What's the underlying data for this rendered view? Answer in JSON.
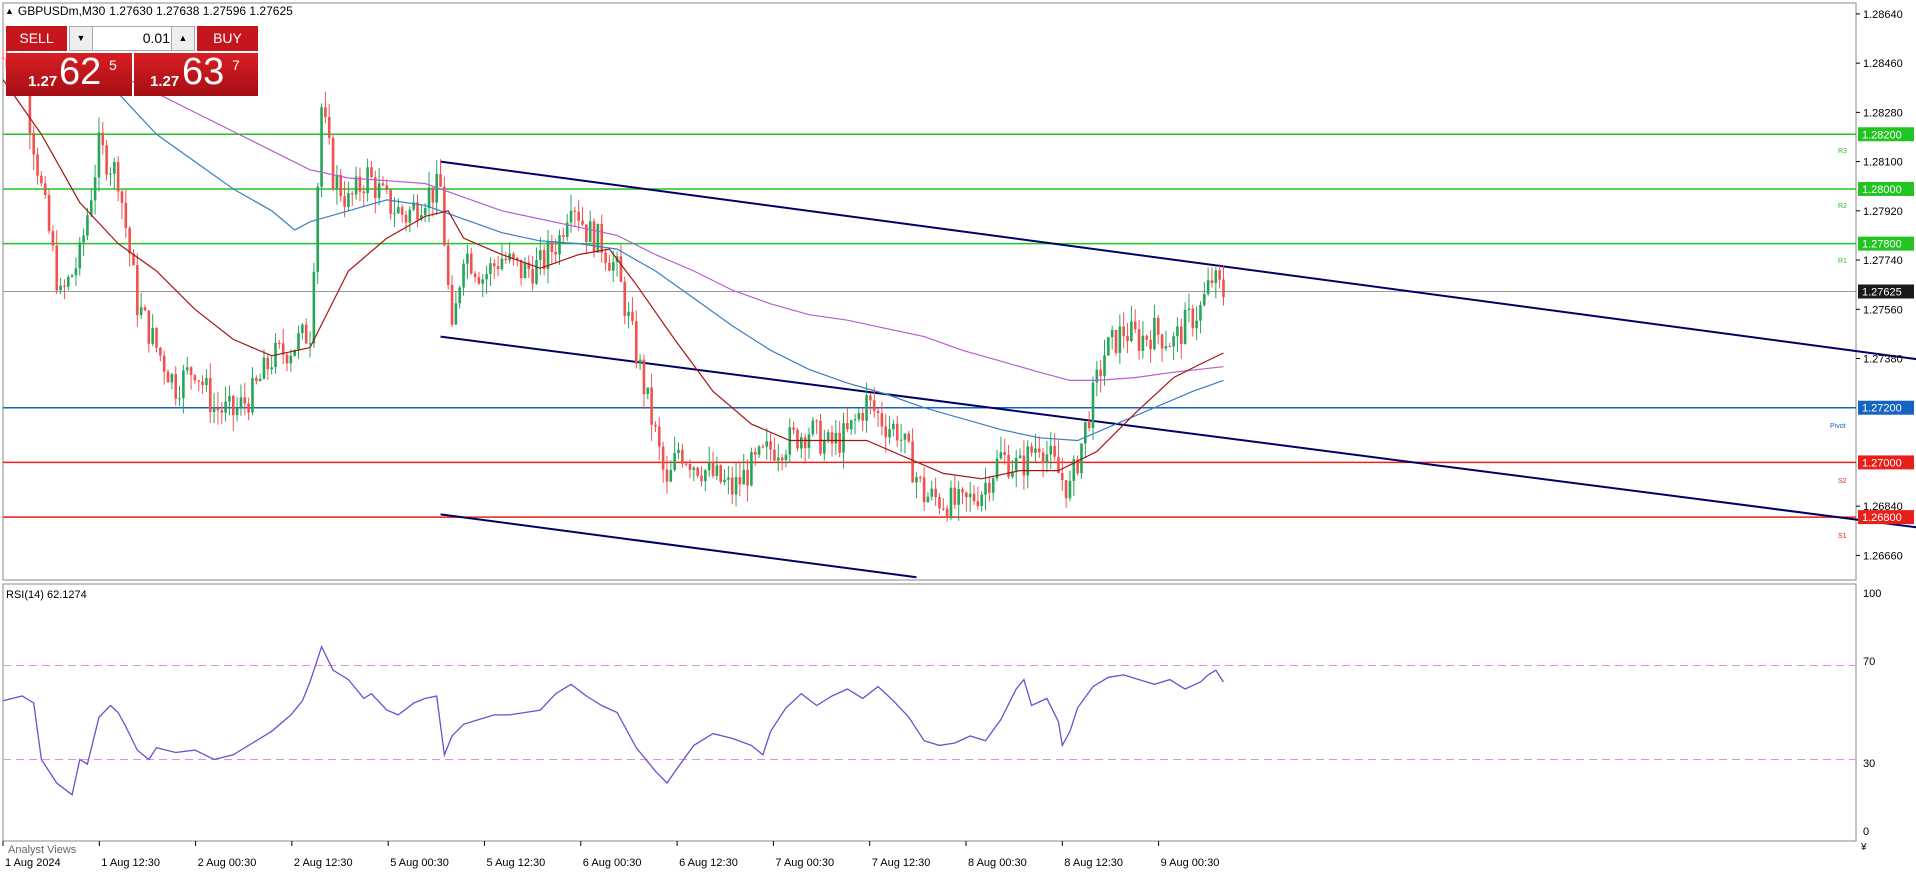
{
  "symbol_header": {
    "symbol_tf": "GBPUSDm,M30",
    "ohlc": "1.27630 1.27638 1.27596 1.27625"
  },
  "trade_panel": {
    "sell_label": "SELL",
    "buy_label": "BUY",
    "lot_value": "0.01",
    "bid": {
      "prefix": "1.27",
      "big": "62",
      "sup": "5"
    },
    "ask": {
      "prefix": "1.27",
      "big": "63",
      "sup": "7"
    }
  },
  "colors": {
    "bull": "#26a65b",
    "bear": "#ef5350",
    "ma_fast": "#a31515",
    "ma_mid": "#3a7fbf",
    "ma_slow": "#b55fd0",
    "channel": "#000066",
    "resistance": "#22c422",
    "support": "#e8201c",
    "pivot": "#1565c0",
    "rsi": "#6b4fd0",
    "rsi_levels": "#e090e0"
  },
  "chart_data": [
    {
      "type": "candlestick",
      "y_ticks": [
        "1.28640",
        "1.28460",
        "1.28280",
        "1.28100",
        "1.27920",
        "1.27740",
        "1.27560",
        "1.27380",
        "1.26840",
        "1.26660"
      ],
      "ylim": [
        1.2657,
        1.2868
      ],
      "x_ticks": [
        "1 Aug 2024",
        "1 Aug 12:30",
        "2 Aug 00:30",
        "2 Aug 12:30",
        "5 Aug 00:30",
        "5 Aug 12:30",
        "6 Aug 00:30",
        "6 Aug 12:30",
        "7 Aug 00:30",
        "7 Aug 12:30",
        "8 Aug 00:30",
        "8 Aug 12:30",
        "9 Aug 00:30"
      ],
      "current_price": "1.27625",
      "levels": [
        {
          "name": "R3",
          "price": "1.28200",
          "color": "#22c422"
        },
        {
          "name": "R2",
          "price": "1.28000",
          "color": "#22c422"
        },
        {
          "name": "R1",
          "price": "1.27800",
          "color": "#22c422"
        },
        {
          "name": "Pivot",
          "price": "1.27200",
          "color": "#1565c0"
        },
        {
          "name": "S2",
          "price": "1.27000",
          "color": "#e8201c"
        },
        {
          "name": "S1",
          "price": "1.26800",
          "color": "#e8201c"
        }
      ],
      "close_path": [
        [
          0,
          1.2848
        ],
        [
          5,
          1.2843
        ],
        [
          10,
          1.28
        ],
        [
          15,
          1.276
        ],
        [
          20,
          1.2775
        ],
        [
          25,
          1.2815
        ],
        [
          30,
          1.2805
        ],
        [
          35,
          1.2758
        ],
        [
          40,
          1.2742
        ],
        [
          45,
          1.2728
        ],
        [
          50,
          1.2735
        ],
        [
          55,
          1.272
        ],
        [
          60,
          1.2718
        ],
        [
          65,
          1.2725
        ],
        [
          70,
          1.2738
        ],
        [
          75,
          1.2742
        ],
        [
          80,
          1.2748
        ],
        [
          83,
          1.283
        ],
        [
          86,
          1.2805
        ],
        [
          90,
          1.2795
        ],
        [
          95,
          1.2805
        ],
        [
          100,
          1.2795
        ],
        [
          105,
          1.279
        ],
        [
          110,
          1.2798
        ],
        [
          114,
          1.28
        ],
        [
          117,
          1.2745
        ],
        [
          120,
          1.2778
        ],
        [
          125,
          1.2768
        ],
        [
          130,
          1.2775
        ],
        [
          135,
          1.277
        ],
        [
          140,
          1.2772
        ],
        [
          145,
          1.2782
        ],
        [
          148,
          1.2798
        ],
        [
          152,
          1.2785
        ],
        [
          156,
          1.278
        ],
        [
          160,
          1.277
        ],
        [
          165,
          1.274
        ],
        [
          170,
          1.271
        ],
        [
          173,
          1.269
        ],
        [
          176,
          1.2705
        ],
        [
          180,
          1.27
        ],
        [
          185,
          1.2695
        ],
        [
          190,
          1.269
        ],
        [
          195,
          1.2698
        ],
        [
          200,
          1.2705
        ],
        [
          205,
          1.2708
        ],
        [
          210,
          1.2712
        ],
        [
          215,
          1.2706
        ],
        [
          220,
          1.271
        ],
        [
          225,
          1.2722
        ],
        [
          230,
          1.2714
        ],
        [
          233,
          1.2712
        ],
        [
          236,
          1.2702
        ],
        [
          240,
          1.2688
        ],
        [
          245,
          1.2686
        ],
        [
          250,
          1.2684
        ],
        [
          255,
          1.269
        ],
        [
          260,
          1.2702
        ],
        [
          265,
          1.2698
        ],
        [
          270,
          1.2708
        ],
        [
          275,
          1.2696
        ],
        [
          278,
          1.269
        ],
        [
          283,
          1.2718
        ],
        [
          287,
          1.274
        ],
        [
          292,
          1.2748
        ],
        [
          296,
          1.2745
        ],
        [
          300,
          1.2748
        ],
        [
          305,
          1.2744
        ],
        [
          309,
          1.2752
        ],
        [
          312,
          1.2756
        ],
        [
          315,
          1.2767
        ],
        [
          318,
          1.2762
        ]
      ],
      "ma_fast": [
        [
          0,
          1.284
        ],
        [
          10,
          1.282
        ],
        [
          20,
          1.2795
        ],
        [
          30,
          1.278
        ],
        [
          40,
          1.277
        ],
        [
          50,
          1.2756
        ],
        [
          60,
          1.2745
        ],
        [
          70,
          1.2739
        ],
        [
          80,
          1.2742
        ],
        [
          90,
          1.277
        ],
        [
          100,
          1.2782
        ],
        [
          110,
          1.279
        ],
        [
          116,
          1.2792
        ],
        [
          120,
          1.2782
        ],
        [
          130,
          1.2776
        ],
        [
          140,
          1.2771
        ],
        [
          150,
          1.2776
        ],
        [
          158,
          1.2778
        ],
        [
          165,
          1.2765
        ],
        [
          175,
          1.2745
        ],
        [
          185,
          1.2726
        ],
        [
          195,
          1.2714
        ],
        [
          205,
          1.2708
        ],
        [
          215,
          1.2708
        ],
        [
          225,
          1.2708
        ],
        [
          235,
          1.2702
        ],
        [
          245,
          1.2696
        ],
        [
          255,
          1.2694
        ],
        [
          265,
          1.2697
        ],
        [
          275,
          1.2697
        ],
        [
          285,
          1.2704
        ],
        [
          295,
          1.2718
        ],
        [
          305,
          1.2731
        ],
        [
          312,
          1.2736
        ],
        [
          318,
          1.274
        ]
      ],
      "ma_mid": [
        [
          20,
          1.284
        ],
        [
          30,
          1.2835
        ],
        [
          40,
          1.282
        ],
        [
          50,
          1.281
        ],
        [
          60,
          1.28
        ],
        [
          70,
          1.2792
        ],
        [
          76,
          1.2785
        ],
        [
          80,
          1.2788
        ],
        [
          90,
          1.2792
        ],
        [
          100,
          1.2796
        ],
        [
          110,
          1.2794
        ],
        [
          118,
          1.279
        ],
        [
          130,
          1.2784
        ],
        [
          140,
          1.2781
        ],
        [
          150,
          1.278
        ],
        [
          160,
          1.2778
        ],
        [
          170,
          1.277
        ],
        [
          180,
          1.276
        ],
        [
          190,
          1.275
        ],
        [
          200,
          1.2741
        ],
        [
          210,
          1.2734
        ],
        [
          220,
          1.2729
        ],
        [
          230,
          1.2725
        ],
        [
          240,
          1.272
        ],
        [
          250,
          1.2716
        ],
        [
          260,
          1.2712
        ],
        [
          270,
          1.2709
        ],
        [
          280,
          1.2708
        ],
        [
          290,
          1.2714
        ],
        [
          300,
          1.272
        ],
        [
          310,
          1.2726
        ],
        [
          318,
          1.273
        ]
      ],
      "ma_slow": [
        [
          30,
          1.2842
        ],
        [
          40,
          1.2835
        ],
        [
          50,
          1.2828
        ],
        [
          60,
          1.2821
        ],
        [
          70,
          1.2814
        ],
        [
          80,
          1.2807
        ],
        [
          90,
          1.2804
        ],
        [
          100,
          1.2803
        ],
        [
          110,
          1.2802
        ],
        [
          120,
          1.2797
        ],
        [
          130,
          1.2792
        ],
        [
          140,
          1.2789
        ],
        [
          150,
          1.2786
        ],
        [
          160,
          1.2783
        ],
        [
          170,
          1.2776
        ],
        [
          180,
          1.277
        ],
        [
          190,
          1.2763
        ],
        [
          200,
          1.2758
        ],
        [
          210,
          1.2754
        ],
        [
          220,
          1.2752
        ],
        [
          230,
          1.2749
        ],
        [
          240,
          1.2746
        ],
        [
          250,
          1.2741
        ],
        [
          260,
          1.2737
        ],
        [
          270,
          1.2733
        ],
        [
          278,
          1.273
        ],
        [
          285,
          1.273
        ],
        [
          295,
          1.2731
        ],
        [
          305,
          1.2733
        ],
        [
          318,
          1.2735
        ]
      ],
      "channel_lines": [
        [
          [
            114,
            1.281
          ],
          [
            500,
            1.27375
          ]
        ],
        [
          [
            114,
            1.2746
          ],
          [
            500,
            1.2676
          ]
        ],
        [
          [
            114,
            1.2681
          ],
          [
            238,
            1.2658
          ]
        ]
      ]
    },
    {
      "type": "line",
      "label": "RSI(14) 62.1274",
      "ylim": [
        0,
        100
      ],
      "y_ticks": [
        "100",
        "70",
        "30",
        "0"
      ],
      "levels": [
        70,
        30
      ],
      "values": [
        [
          0,
          55
        ],
        [
          5,
          57
        ],
        [
          8,
          54
        ],
        [
          10,
          30
        ],
        [
          14,
          20
        ],
        [
          18,
          15
        ],
        [
          20,
          30
        ],
        [
          22,
          28
        ],
        [
          25,
          48
        ],
        [
          28,
          53
        ],
        [
          30,
          50
        ],
        [
          32,
          44
        ],
        [
          35,
          34
        ],
        [
          38,
          30
        ],
        [
          40,
          35
        ],
        [
          45,
          33
        ],
        [
          50,
          34
        ],
        [
          55,
          30
        ],
        [
          60,
          32
        ],
        [
          65,
          37
        ],
        [
          70,
          42
        ],
        [
          75,
          49
        ],
        [
          78,
          55
        ],
        [
          80,
          63
        ],
        [
          83,
          78
        ],
        [
          86,
          68
        ],
        [
          90,
          64
        ],
        [
          94,
          56
        ],
        [
          96,
          58
        ],
        [
          100,
          51
        ],
        [
          103,
          49
        ],
        [
          107,
          54
        ],
        [
          110,
          56
        ],
        [
          113,
          57
        ],
        [
          115,
          32
        ],
        [
          117,
          40
        ],
        [
          120,
          45
        ],
        [
          124,
          47
        ],
        [
          128,
          49
        ],
        [
          132,
          49
        ],
        [
          136,
          50
        ],
        [
          140,
          51
        ],
        [
          144,
          58
        ],
        [
          148,
          62
        ],
        [
          152,
          57
        ],
        [
          156,
          53
        ],
        [
          160,
          50
        ],
        [
          165,
          35
        ],
        [
          170,
          25
        ],
        [
          173,
          20
        ],
        [
          176,
          27
        ],
        [
          180,
          36
        ],
        [
          185,
          41
        ],
        [
          190,
          39
        ],
        [
          195,
          36
        ],
        [
          198,
          32
        ],
        [
          200,
          42
        ],
        [
          204,
          52
        ],
        [
          208,
          58
        ],
        [
          212,
          53
        ],
        [
          216,
          57
        ],
        [
          220,
          60
        ],
        [
          224,
          56
        ],
        [
          228,
          61
        ],
        [
          232,
          55
        ],
        [
          236,
          48
        ],
        [
          240,
          38
        ],
        [
          244,
          36
        ],
        [
          248,
          37
        ],
        [
          252,
          40
        ],
        [
          256,
          38
        ],
        [
          260,
          47
        ],
        [
          264,
          60
        ],
        [
          266,
          64
        ],
        [
          268,
          53
        ],
        [
          272,
          56
        ],
        [
          275,
          46
        ],
        [
          276,
          36
        ],
        [
          278,
          42
        ],
        [
          280,
          52
        ],
        [
          284,
          61
        ],
        [
          288,
          65
        ],
        [
          292,
          66
        ],
        [
          296,
          64
        ],
        [
          300,
          62
        ],
        [
          304,
          64
        ],
        [
          308,
          60
        ],
        [
          312,
          63
        ],
        [
          314,
          66
        ],
        [
          316,
          68
        ],
        [
          318,
          63
        ]
      ]
    }
  ],
  "rsi_label": "RSI(14) 62.1274",
  "rsi_tick_labels": [
    "100",
    "70",
    "30",
    "0"
  ],
  "level_tags": [
    "R3",
    "R2",
    "R1",
    "Pivot",
    "S2",
    "S1"
  ],
  "bottom_tab_label": "Analyst Views"
}
